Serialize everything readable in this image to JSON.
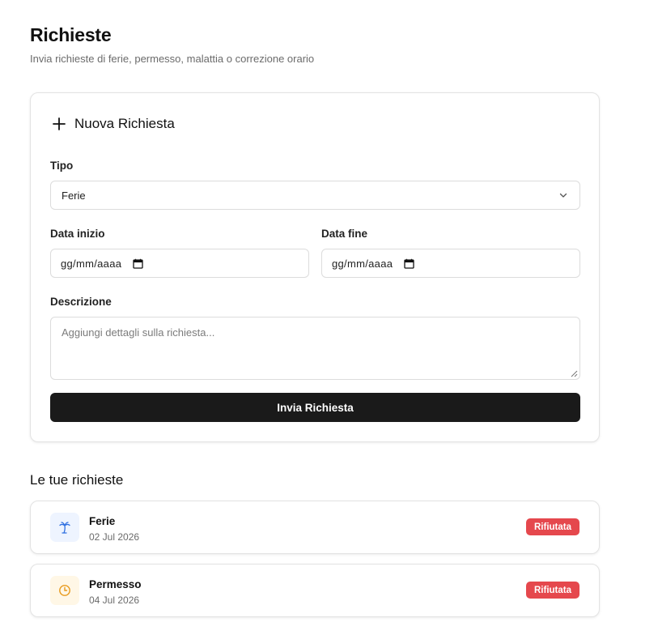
{
  "header": {
    "title": "Richieste",
    "subtitle": "Invia richieste di ferie, permesso, malattia o correzione orario"
  },
  "form": {
    "title": "Nuova Richiesta",
    "type_label": "Tipo",
    "type_value": "Ferie",
    "start_label": "Data inizio",
    "start_value": "gg/mm/aaaa",
    "end_label": "Data fine",
    "end_value": "gg/mm/aaaa",
    "description_label": "Descrizione",
    "description_placeholder": "Aggiungi dettagli sulla richiesta...",
    "submit_label": "Invia Richiesta"
  },
  "requests_section": {
    "title": "Le tue richieste",
    "items": [
      {
        "type": "Ferie",
        "date": "02 Jul 2026",
        "status": "Rifiutata",
        "icon": "palm-tree-icon",
        "icon_bg": "#eef4ff",
        "icon_color": "#2f6fe0"
      },
      {
        "type": "Permesso",
        "date": "04 Jul 2026",
        "status": "Rifiutata",
        "icon": "clock-icon",
        "icon_bg": "#fff7e6",
        "icon_color": "#e89a1c"
      }
    ]
  },
  "colors": {
    "badge_rejected": "#e5484d",
    "button_bg": "#1a1a1a"
  }
}
